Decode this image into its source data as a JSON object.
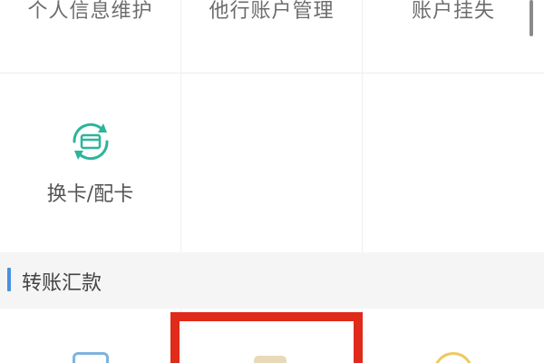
{
  "top_row": {
    "items": [
      {
        "label": "个人信息维护"
      },
      {
        "label": "他行账户管理"
      },
      {
        "label": "账户挂失"
      }
    ]
  },
  "mid_row": {
    "items": [
      {
        "label": "换卡/配卡",
        "icon": "card-exchange-icon"
      }
    ]
  },
  "section": {
    "title": "转账汇款",
    "accent_color": "#4a90e2"
  },
  "colors": {
    "highlight": "#e02a1a",
    "icon_teal": "#2bb59a"
  }
}
